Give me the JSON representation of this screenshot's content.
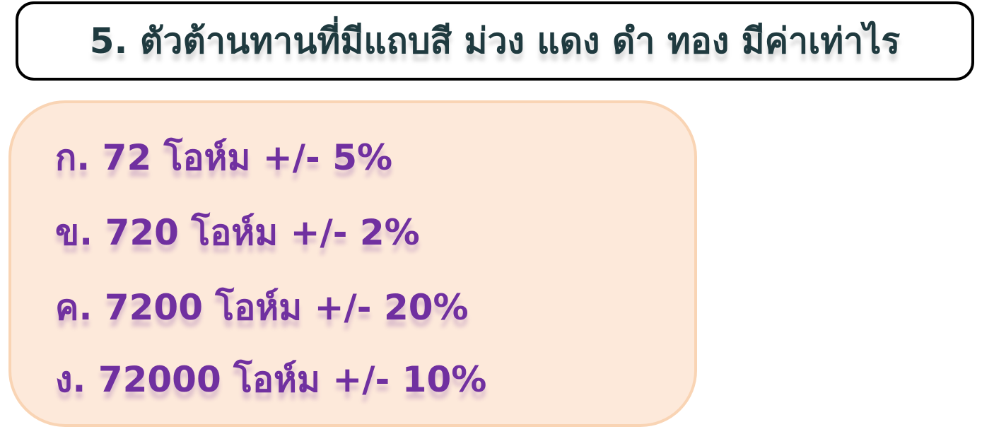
{
  "question": {
    "title": "5. ตัวต้านทานที่มีแถบสี ม่วง แดง ดำ ทอง มีค่าเท่าไร"
  },
  "options": [
    {
      "label": "ก. 72 โอห์ม +/- 5%"
    },
    {
      "label": "ข. 720 โอห์ม +/- 2%"
    },
    {
      "label": "ค. 7200 โอห์ม +/- 20%"
    },
    {
      "label": "ง. 72000 โอห์ม +/- 10%"
    }
  ],
  "colors": {
    "title_text": "#1f3a3f",
    "option_text": "#7030a0",
    "panel_fill": "#fde9da",
    "panel_border": "#f9d4b4"
  }
}
